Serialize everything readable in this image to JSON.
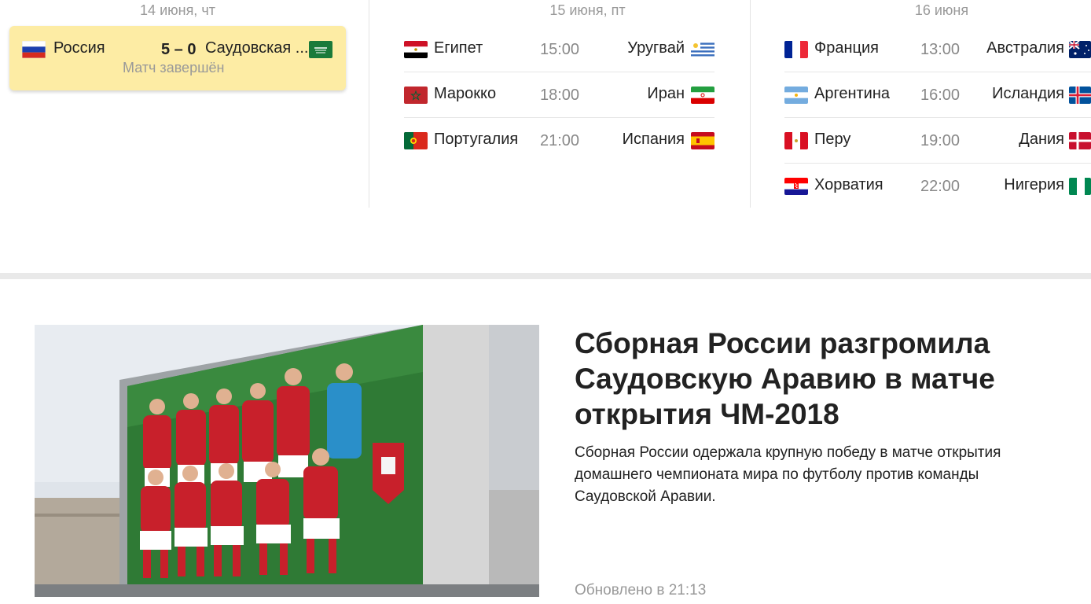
{
  "schedule": {
    "days": [
      {
        "title": "14 июня, чт",
        "matches": [
          {
            "home": "Россия",
            "away": "Саудовская ...",
            "score": "5 – 0",
            "status": "Матч завершён",
            "home_flag": "russia-flag-icon",
            "away_flag": "saudi-arabia-flag-icon",
            "highlight_color": "#fdeca4"
          }
        ]
      },
      {
        "title": "15 июня, пт",
        "matches": [
          {
            "home": "Египет",
            "time": "15:00",
            "away": "Уругвай",
            "home_flag": "egypt-flag-icon",
            "away_flag": "uruguay-flag-icon"
          },
          {
            "home": "Марокко",
            "time": "18:00",
            "away": "Иран",
            "home_flag": "morocco-flag-icon",
            "away_flag": "iran-flag-icon"
          },
          {
            "home": "Португалия",
            "time": "21:00",
            "away": "Испания",
            "home_flag": "portugal-flag-icon",
            "away_flag": "spain-flag-icon"
          }
        ]
      },
      {
        "title": "16 июня",
        "matches": [
          {
            "home": "Франция",
            "time": "13:00",
            "away": "Австралия",
            "home_flag": "france-flag-icon",
            "away_flag": "australia-flag-icon"
          },
          {
            "home": "Аргентина",
            "time": "16:00",
            "away": "Исландия",
            "home_flag": "argentina-flag-icon",
            "away_flag": "iceland-flag-icon"
          },
          {
            "home": "Перу",
            "time": "19:00",
            "away": "Дания",
            "home_flag": "peru-flag-icon",
            "away_flag": "denmark-flag-icon"
          },
          {
            "home": "Хорватия",
            "time": "22:00",
            "away": "Нигерия",
            "home_flag": "croatia-flag-icon",
            "away_flag": "nigeria-flag-icon"
          }
        ]
      }
    ]
  },
  "news": {
    "title": "Сборная России разгромила Саудовскую Аравию в матче открытия ЧМ-2018",
    "text": "Сборная России одержала крупную победу в матче открытия домашнего чемпионата мира по футболу против команды Саудовской Аравии.",
    "updated": "Обновлено в 21:13",
    "image_icon": "team-photo-image"
  },
  "colors": {
    "accent_highlight": "#fdeca4",
    "text_muted": "#999999",
    "separator": "#e9e9e9"
  }
}
